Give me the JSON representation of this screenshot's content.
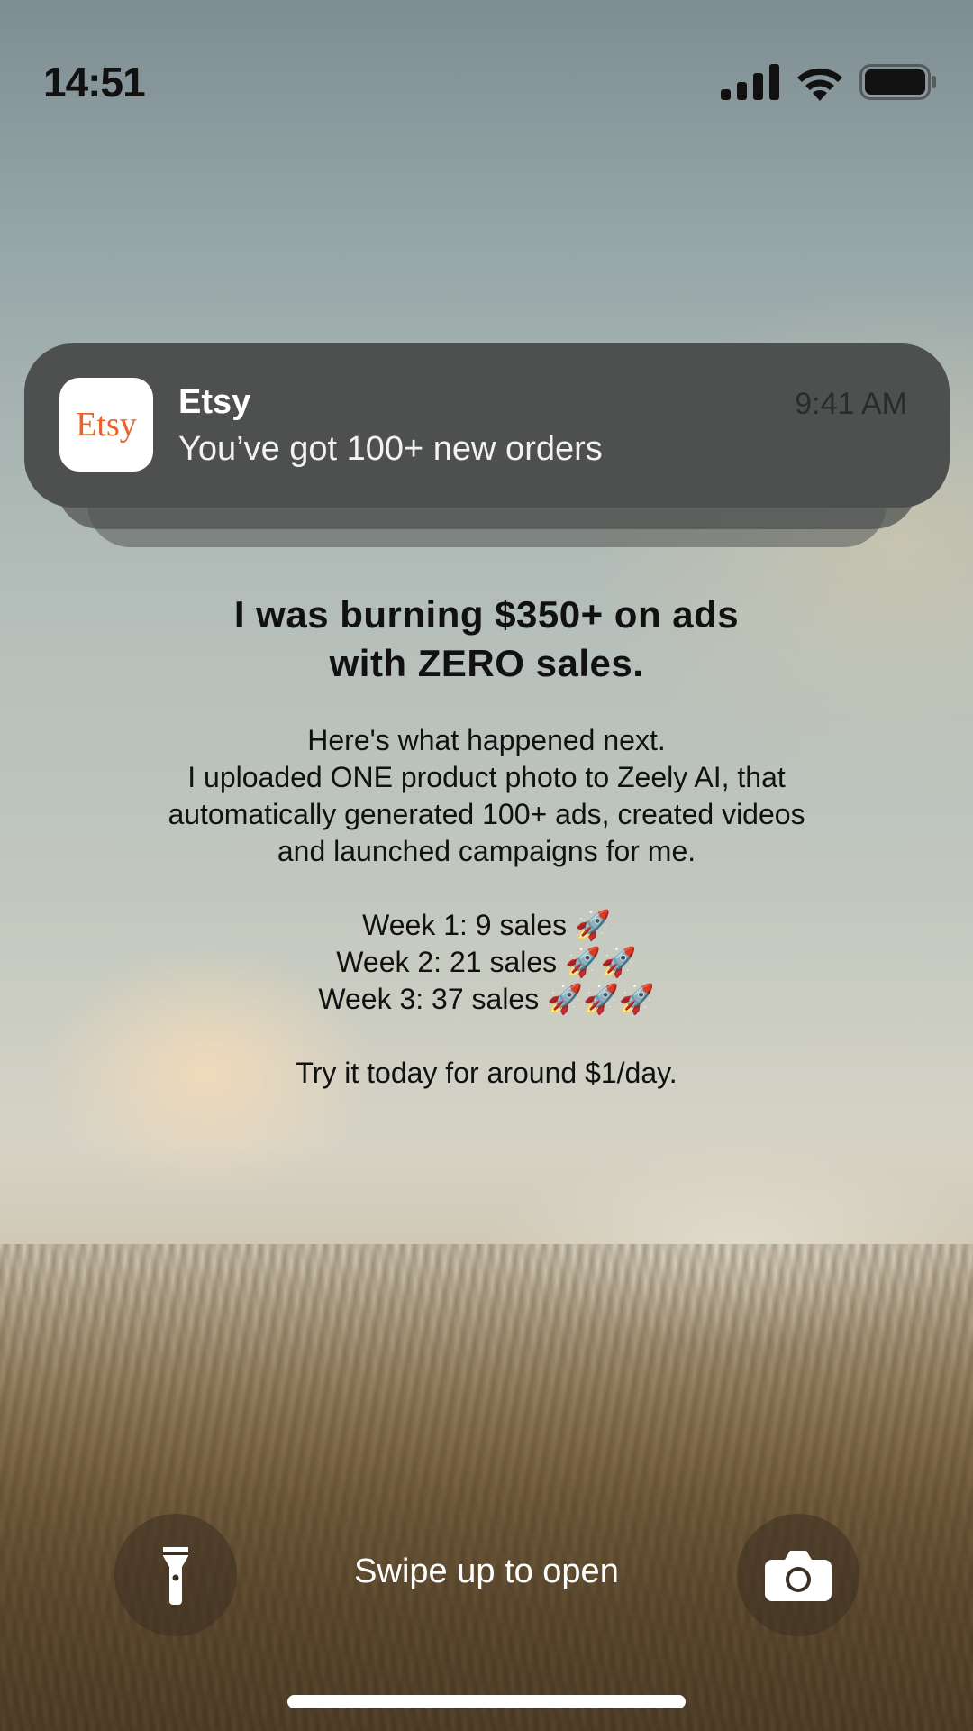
{
  "status_bar": {
    "time": "14:51",
    "icons": [
      "cellular-signal-icon",
      "wifi-icon",
      "battery-icon"
    ]
  },
  "notification": {
    "app_icon_text": "Etsy",
    "app_name": "Etsy",
    "message": "You’ve got 100+ new orders",
    "time": "9:41 AM"
  },
  "ad": {
    "headline": [
      "I was burning $350+ on ads",
      "with ZERO sales."
    ],
    "body": [
      "Here's what happened next.",
      "I uploaded ONE product photo to Zeely AI, that",
      "automatically generated 100+ ads, created videos",
      "and launched campaigns for me."
    ],
    "weeks": [
      "Week 1: 9 sales 🚀",
      "Week 2: 21 sales 🚀🚀",
      "Week 3: 37 sales 🚀🚀🚀"
    ],
    "cta": "Try it today for around $1/day."
  },
  "lock_screen": {
    "left_button_icon": "flashlight-icon",
    "swipe_text": "Swipe up to open",
    "right_button_icon": "camera-icon"
  },
  "colors": {
    "etsy_orange": "#e6642a",
    "notification_bg": "#4d504e"
  }
}
